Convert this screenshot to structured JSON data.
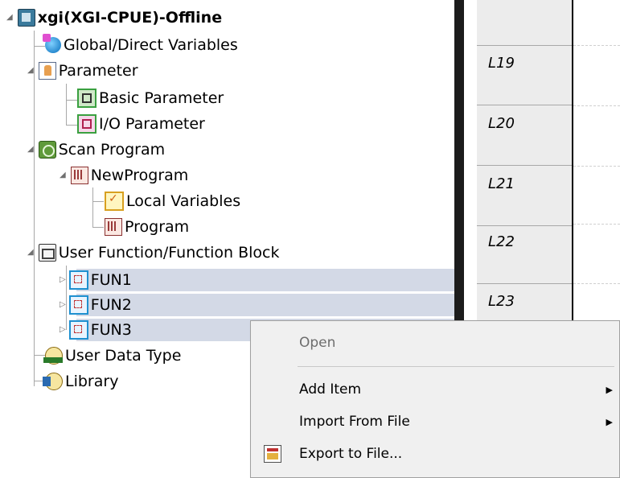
{
  "tree": {
    "root": {
      "label": "xgi(XGI-CPUE)-Offline",
      "icon": "plc-project-icon"
    },
    "items": [
      {
        "label": "Global/Direct Variables",
        "icon": "global-variables-icon"
      },
      {
        "label": "Parameter",
        "icon": "parameter-icon"
      },
      {
        "label": "Basic Parameter",
        "icon": "basic-parameter-icon"
      },
      {
        "label": "I/O Parameter",
        "icon": "io-parameter-icon"
      },
      {
        "label": "Scan Program",
        "icon": "scan-program-icon"
      },
      {
        "label": "NewProgram",
        "icon": "program-icon"
      },
      {
        "label": "Local Variables",
        "icon": "local-variables-icon"
      },
      {
        "label": "Program",
        "icon": "program-icon"
      },
      {
        "label": "User Function/Function Block",
        "icon": "function-block-icon"
      },
      {
        "label": "FUN1",
        "icon": "function-icon"
      },
      {
        "label": "FUN2",
        "icon": "function-icon"
      },
      {
        "label": "FUN3",
        "icon": "function-icon"
      },
      {
        "label": "User Data Type",
        "icon": "user-data-type-icon"
      },
      {
        "label": "Library",
        "icon": "library-icon"
      }
    ]
  },
  "ladder": {
    "rungs": [
      "L19",
      "L20",
      "L21",
      "L22",
      "L23"
    ]
  },
  "context_menu": {
    "items": [
      {
        "label": "Open",
        "enabled": false
      },
      {
        "label": "Add Item",
        "submenu": true
      },
      {
        "label": "Import From File",
        "submenu": true
      },
      {
        "label": "Export to File...",
        "icon": "export-icon"
      }
    ]
  },
  "colors": {
    "selection": "#d3d9e6",
    "menu_background": "#f0f0f0",
    "disabled_text": "#6d6d6d",
    "splitter": "#1c1c1c"
  }
}
